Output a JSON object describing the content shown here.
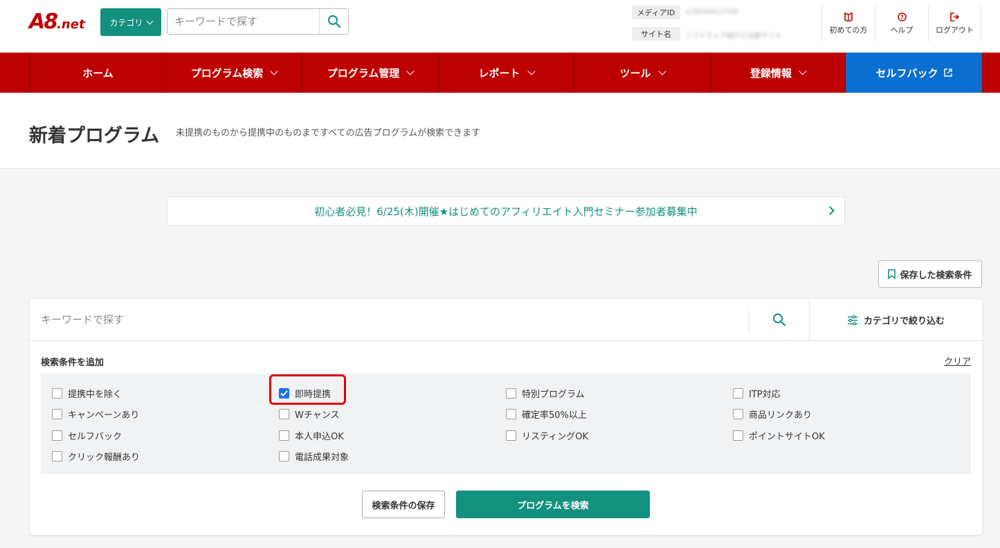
{
  "header": {
    "logo_main": "A8",
    "logo_sub": ".net",
    "category_button": "カテゴリ",
    "search_placeholder": "キーワードで探す",
    "media_id_label": "メディアID",
    "media_id_value": "a18000012768",
    "site_name_label": "サイト名",
    "site_name_value": "ソフトウェア紹介と比較サイト",
    "util_links": [
      {
        "label": "初めての方",
        "icon": "book-icon"
      },
      {
        "label": "ヘルプ",
        "icon": "help-icon"
      },
      {
        "label": "ログアウト",
        "icon": "logout-icon"
      }
    ]
  },
  "nav": {
    "items": [
      {
        "label": "ホーム",
        "dropdown": false
      },
      {
        "label": "プログラム検索",
        "dropdown": true
      },
      {
        "label": "プログラム管理",
        "dropdown": true
      },
      {
        "label": "レポート",
        "dropdown": true
      },
      {
        "label": "ツール",
        "dropdown": true
      },
      {
        "label": "登録情報",
        "dropdown": true
      },
      {
        "label": "セルフバック",
        "dropdown": false,
        "external": true
      }
    ]
  },
  "page": {
    "title": "新着プログラム",
    "subtitle": "未提携のものから提携中のものまですべての広告プログラムが検索できます"
  },
  "banner": {
    "text": "初心者必見！6/25(木)開催★はじめてのアフィリエイト入門セミナー参加者募集中"
  },
  "saved_search_button": "保存した検索条件",
  "panel": {
    "search_placeholder": "キーワードで探す",
    "category_filter": "カテゴリで絞り込む",
    "conditions_title": "検索条件を追加",
    "clear_label": "クリア",
    "conditions": [
      {
        "label": "提携中を除く",
        "checked": false
      },
      {
        "label": "即時提携",
        "checked": true
      },
      {
        "label": "特別プログラム",
        "checked": false
      },
      {
        "label": "ITP対応",
        "checked": false
      },
      {
        "label": "キャンペーンあり",
        "checked": false
      },
      {
        "label": "Wチャンス",
        "checked": false
      },
      {
        "label": "確定率50%以上",
        "checked": false
      },
      {
        "label": "商品リンクあり",
        "checked": false
      },
      {
        "label": "セルフバック",
        "checked": false
      },
      {
        "label": "本人申込OK",
        "checked": false
      },
      {
        "label": "リスティングOK",
        "checked": false
      },
      {
        "label": "ポイントサイトOK",
        "checked": false
      },
      {
        "label": "クリック報酬あり",
        "checked": false
      },
      {
        "label": "電話成果対象",
        "checked": false
      }
    ],
    "save_conditions_button": "検索条件の保存",
    "search_programs_button": "プログラムを検索"
  },
  "colors": {
    "brand_red": "#bd0000",
    "teal": "#13907e",
    "selfback_blue": "#0a6fd0",
    "highlight_red": "#e00000"
  }
}
